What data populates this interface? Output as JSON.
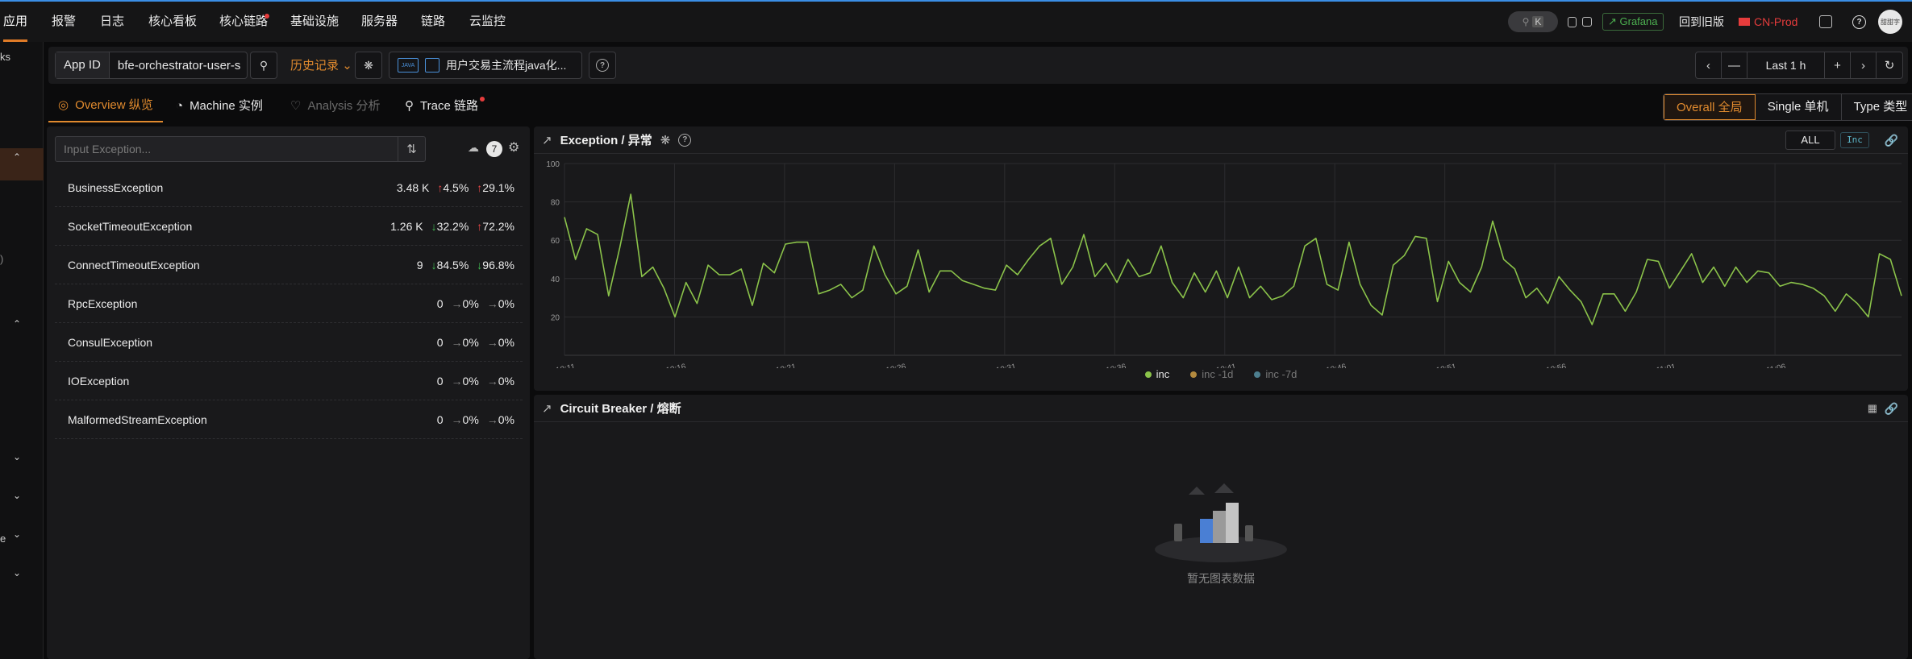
{
  "nav": {
    "items": [
      {
        "label": "应用",
        "active": true,
        "dot": false
      },
      {
        "label": "报警",
        "active": false,
        "dot": false
      },
      {
        "label": "日志",
        "active": false,
        "dot": false
      },
      {
        "label": "核心看板",
        "active": false,
        "dot": false
      },
      {
        "label": "核心链路",
        "active": false,
        "dot": true
      },
      {
        "label": "基础设施",
        "active": false,
        "dot": false
      },
      {
        "label": "服务器",
        "active": false,
        "dot": false
      },
      {
        "label": "链路",
        "active": false,
        "dot": false
      },
      {
        "label": "云监控",
        "active": false,
        "dot": false
      }
    ],
    "right": {
      "kbd_hint": "K",
      "grafana_label": "Grafana",
      "back_old_label": "回到旧版",
      "env_label": "CN-Prod",
      "avatar_text": "甜甜字"
    }
  },
  "sidebar": {
    "partial_texts": [
      "ks",
      "e"
    ]
  },
  "toolbar": {
    "appid_label": "App ID",
    "appid_value": "bfe-orchestrator-user-s",
    "history_label": "历史记录",
    "flow_label": "用户交易主流程java化...",
    "flow_icon_text": "JAVA",
    "time_range": "Last 1 h"
  },
  "tabs": [
    {
      "label": "Overview 纵览",
      "state": "active",
      "icon": "globe-icon"
    },
    {
      "label": "Machine 实例",
      "state": "normal",
      "icon": "pie-icon"
    },
    {
      "label": "Analysis 分析",
      "state": "disabled",
      "icon": "heart-icon"
    },
    {
      "label": "Trace 链路",
      "state": "normal",
      "icon": "search-icon"
    }
  ],
  "scope": {
    "options": [
      "Overall 全局",
      "Single 单机",
      "Type 类型"
    ],
    "selected": "Overall 全局"
  },
  "exceptions": {
    "search_placeholder": "Input Exception...",
    "count": "7",
    "rows": [
      {
        "name": "BusinessException",
        "count": "3.48 K",
        "d1": "4.5%",
        "d1_dir": "up",
        "d7": "29.1%",
        "d7_dir": "up"
      },
      {
        "name": "SocketTimeoutException",
        "count": "1.26 K",
        "d1": "32.2%",
        "d1_dir": "down",
        "d7": "72.2%",
        "d7_dir": "up"
      },
      {
        "name": "ConnectTimeoutException",
        "count": "9",
        "d1": "84.5%",
        "d1_dir": "down",
        "d7": "96.8%",
        "d7_dir": "down"
      },
      {
        "name": "RpcException",
        "count": "0",
        "d1": "0%",
        "d1_dir": "flat",
        "d7": "0%",
        "d7_dir": "flat"
      },
      {
        "name": "ConsulException",
        "count": "0",
        "d1": "0%",
        "d1_dir": "flat",
        "d7": "0%",
        "d7_dir": "flat"
      },
      {
        "name": "IOException",
        "count": "0",
        "d1": "0%",
        "d1_dir": "flat",
        "d7": "0%",
        "d7_dir": "flat"
      },
      {
        "name": "MalformedStreamException",
        "count": "0",
        "d1": "0%",
        "d1_dir": "flat",
        "d7": "0%",
        "d7_dir": "flat"
      }
    ]
  },
  "exception_panel": {
    "title": "Exception / 异常",
    "all_label": "ALL",
    "inc_label": "Inc"
  },
  "circuit_panel": {
    "title": "Circuit Breaker / 熔断",
    "empty_text": "暂无图表数据"
  },
  "colors": {
    "accent": "#e08a2e",
    "line_inc": "#8bc34a",
    "line_inc_1d": "#b38a3e",
    "line_inc_7d": "#4d7f8f"
  },
  "chart_data": {
    "type": "line",
    "title": "Exception / 异常",
    "ylim": [
      0,
      100
    ],
    "yticks": [
      20,
      40,
      60,
      80,
      100
    ],
    "x_tick_labels": [
      "10:11",
      "10:16",
      "10:21",
      "10:26",
      "10:31",
      "10:36",
      "10:41",
      "10:46",
      "10:51",
      "10:56",
      "11:01",
      "11:06"
    ],
    "grid": true,
    "legend_position": "bottom",
    "series": [
      {
        "name": "inc",
        "color": "#8bc34a",
        "values": [
          72,
          50,
          66,
          63,
          31,
          56,
          84,
          41,
          46,
          35,
          20,
          38,
          27,
          47,
          42,
          42,
          45,
          26,
          48,
          43,
          58,
          59,
          59,
          32,
          34,
          37,
          30,
          34,
          57,
          42,
          32,
          36,
          55,
          33,
          44,
          44,
          39,
          37,
          35,
          34,
          47,
          42,
          50,
          57,
          61,
          37,
          46,
          63,
          41,
          48,
          38,
          50,
          41,
          43,
          57,
          38,
          30,
          43,
          33,
          44,
          30,
          46,
          30,
          36,
          29,
          31,
          36,
          57,
          61,
          37,
          34,
          59,
          37,
          26,
          21,
          47,
          52,
          62,
          61,
          28,
          49,
          38,
          33,
          46,
          70,
          50,
          45,
          30,
          35,
          27,
          41,
          34,
          28,
          16,
          32,
          32,
          23,
          33,
          50,
          49,
          35,
          44,
          53,
          38,
          46,
          36,
          46,
          38,
          44,
          43,
          36,
          38,
          37,
          35,
          31,
          23,
          32,
          27,
          20,
          53,
          50,
          31
        ]
      },
      {
        "name": "inc -1d",
        "color": "#b38a3e",
        "values": []
      },
      {
        "name": "inc -7d",
        "color": "#4d7f8f",
        "values": []
      }
    ]
  }
}
